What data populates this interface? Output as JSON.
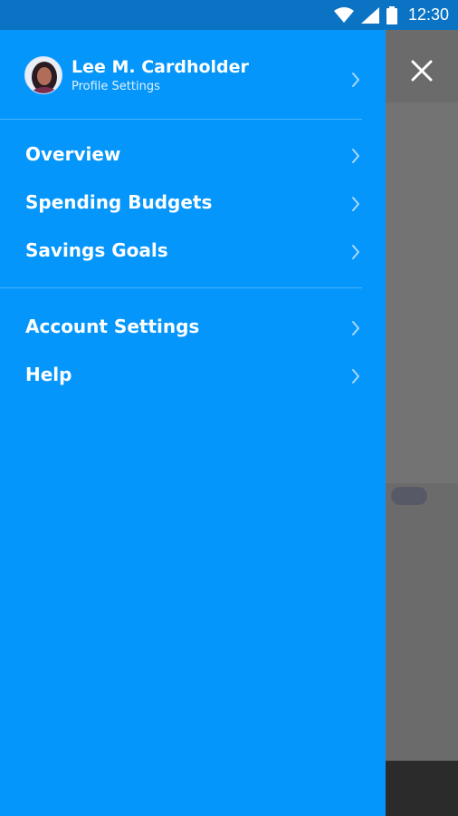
{
  "status_bar": {
    "time": "12:30",
    "icons": [
      "wifi-icon",
      "signal-icon",
      "battery-icon"
    ]
  },
  "drawer": {
    "background": "#0496fb",
    "profile": {
      "name": "Lee M. Cardholder",
      "subtitle": "Profile Settings"
    },
    "main_items": [
      {
        "label": "Overview"
      },
      {
        "label": "Spending Budgets"
      },
      {
        "label": "Savings Goals"
      }
    ],
    "secondary_items": [
      {
        "label": "Account Settings"
      },
      {
        "label": "Help"
      }
    ]
  },
  "close_icon": "close-icon"
}
